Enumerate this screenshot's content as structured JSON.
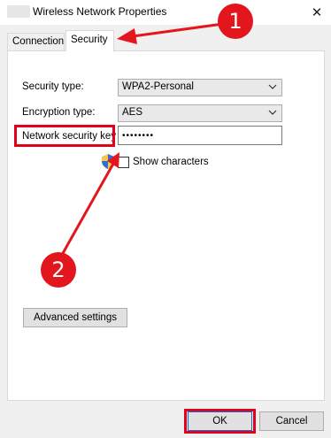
{
  "window": {
    "title": "Wireless Network Properties",
    "close_glyph": "✕"
  },
  "tabs": [
    {
      "label": "Connection",
      "active": false
    },
    {
      "label": "Security",
      "active": true
    }
  ],
  "security": {
    "security_type_label": "Security type:",
    "security_type_value": "WPA2-Personal",
    "encryption_type_label": "Encryption type:",
    "encryption_type_value": "AES",
    "network_key_label": "Network security key",
    "network_key_value": "••••••••",
    "show_characters_label": "Show characters",
    "show_characters_checked": false,
    "advanced_settings_label": "Advanced settings"
  },
  "footer": {
    "ok_label": "OK",
    "cancel_label": "Cancel"
  },
  "annotations": {
    "marker_1": "1",
    "marker_2": "2",
    "color": "#e3151d"
  }
}
